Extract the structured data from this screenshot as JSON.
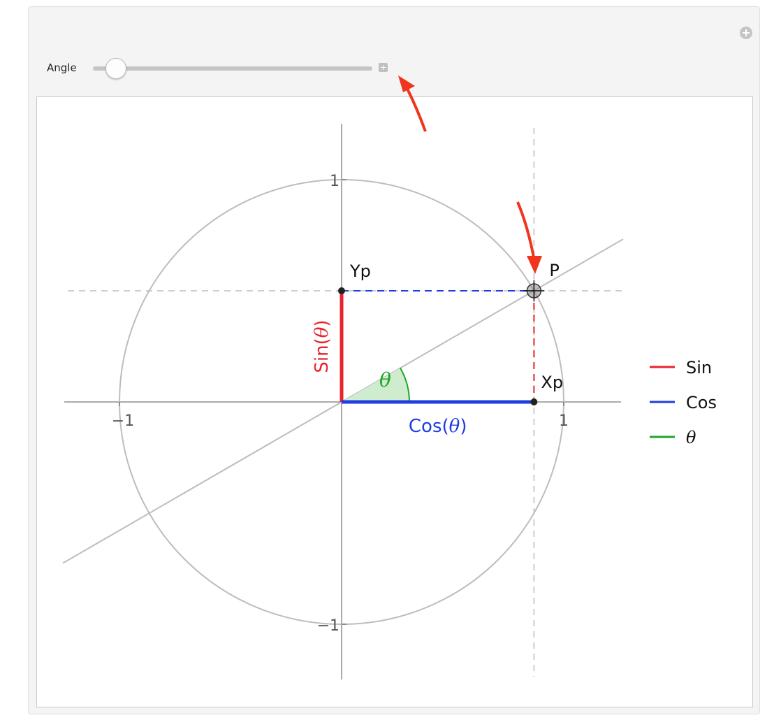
{
  "controls": {
    "angle_label": "Angle",
    "angle_value": 0.524
  },
  "colors": {
    "sin": "#e8232b",
    "cos": "#1f3ee0",
    "theta": "#21a52a",
    "annotation_arrow": "#f0341d"
  },
  "icons": {
    "expand": "plus-circle-icon",
    "slider_options": "plus-square-icon"
  },
  "chart_data": {
    "type": "diagram",
    "xlim": [
      -1.25,
      1.25
    ],
    "ylim": [
      -1.25,
      1.25
    ],
    "grid": false,
    "angle_rad": 0.524,
    "x_ticks": [
      {
        "value": -1,
        "label": "−1"
      },
      {
        "value": 1,
        "label": "1"
      }
    ],
    "y_ticks": [
      {
        "value": 1,
        "label": "1"
      },
      {
        "value": -1,
        "label": "−1"
      }
    ],
    "points": {
      "P": {
        "label": "P",
        "x": 0.866,
        "y": 0.5
      },
      "Xp": {
        "label": "Xp",
        "x": 0.866,
        "y": 0
      },
      "Yp": {
        "label": "Yp",
        "x": 0,
        "y": 0.5
      }
    },
    "segment_labels": {
      "sin_prefix": "Sin(",
      "cos_prefix": "Cos(",
      "theta": "θ",
      "close": ")"
    },
    "legend": {
      "position": "right",
      "items": [
        {
          "label": "Sin",
          "color": "#e8232b"
        },
        {
          "label": "Cos",
          "color": "#1f3ee0"
        },
        {
          "label": "θ",
          "color": "#21a52a"
        }
      ]
    }
  }
}
